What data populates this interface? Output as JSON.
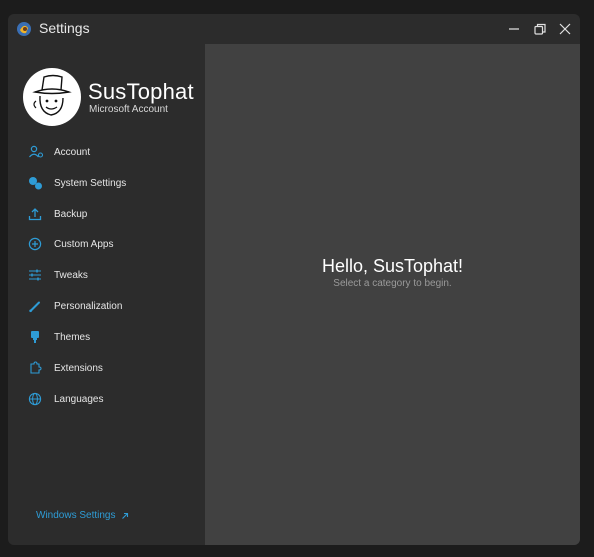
{
  "window": {
    "title": "Settings"
  },
  "user": {
    "name": "SusTophat",
    "account_type": "Microsoft Account"
  },
  "sidebar": {
    "items": [
      {
        "label": "Account",
        "icon": "account-icon"
      },
      {
        "label": "System Settings",
        "icon": "system-settings-icon"
      },
      {
        "label": "Backup",
        "icon": "backup-icon"
      },
      {
        "label": "Custom Apps",
        "icon": "custom-apps-icon"
      },
      {
        "label": "Tweaks",
        "icon": "tweaks-icon"
      },
      {
        "label": "Personalization",
        "icon": "personalization-icon"
      },
      {
        "label": "Themes",
        "icon": "themes-icon"
      },
      {
        "label": "Extensions",
        "icon": "extensions-icon"
      },
      {
        "label": "Languages",
        "icon": "languages-icon"
      }
    ],
    "footer_link": "Windows Settings"
  },
  "main": {
    "greeting": "Hello, SusTophat!",
    "hint": "Select a category to begin."
  },
  "colors": {
    "accent": "#2e9cd6",
    "sidebar_bg": "#2c2c2c",
    "content_bg": "#414141",
    "page_bg": "#1c1c1c"
  }
}
